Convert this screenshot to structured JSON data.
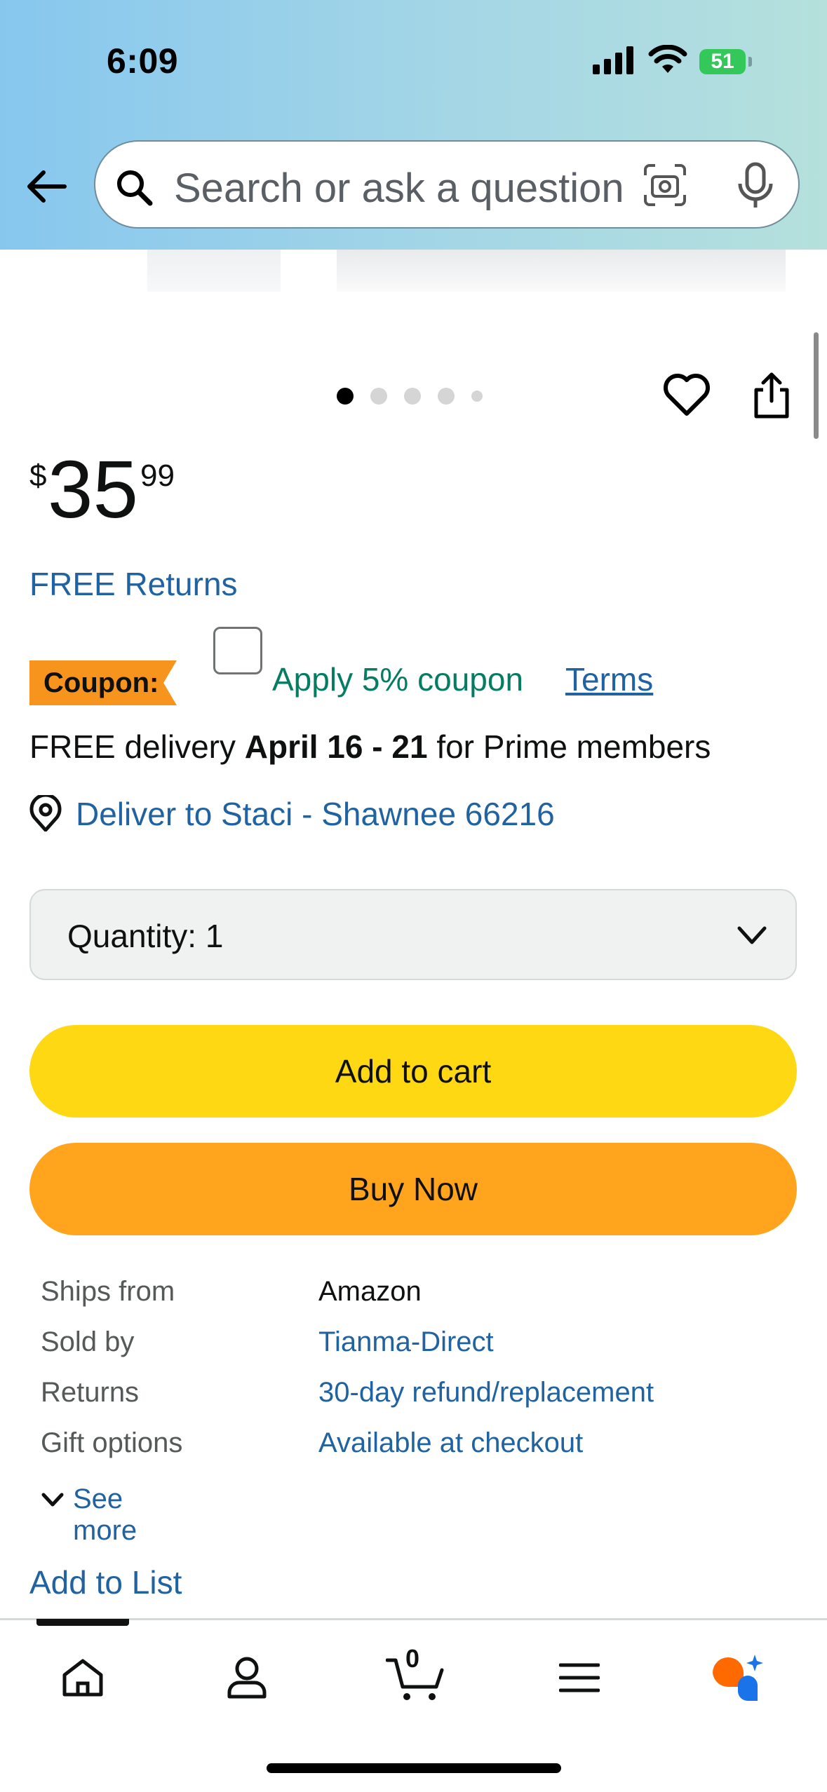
{
  "status_bar": {
    "time": "6:09",
    "battery": "51"
  },
  "search": {
    "placeholder": "Search or ask a question"
  },
  "gallery": {
    "dot_count": 5,
    "active_index": 0
  },
  "price": {
    "symbol": "$",
    "whole": "35",
    "fraction": "99"
  },
  "free_returns": "FREE Returns",
  "coupon": {
    "badge": "Coupon:",
    "text": "Apply 5% coupon",
    "terms": "Terms",
    "checked": false
  },
  "delivery": {
    "prefix": "FREE delivery",
    "dates": "April 16 - 21",
    "suffix": "for Prime members"
  },
  "deliver_to": "Deliver to Staci - Shawnee 66216",
  "quantity": {
    "label": "Quantity:",
    "value": "1"
  },
  "buttons": {
    "add_to_cart": "Add to cart",
    "buy_now": "Buy Now"
  },
  "info": [
    {
      "key": "Ships from",
      "value": "Amazon"
    },
    {
      "key": "Sold by",
      "value": "Tianma-Direct"
    },
    {
      "key": "Returns",
      "value": "30-day refund/replacement"
    },
    {
      "key": "Gift options",
      "value": "Available at checkout"
    }
  ],
  "see_more": "See more",
  "add_to_list": "Add to List",
  "bottom_nav": {
    "items": [
      "home-icon",
      "account-icon",
      "cart-icon",
      "menu-icon",
      "rufus-ai-icon"
    ],
    "cart_count": "0"
  },
  "colors": {
    "link": "#2162a1",
    "coupon_green": "#067d62",
    "add_to_cart": "#ffd814",
    "buy_now": "#ffa41c",
    "coupon_badge": "#f7941e"
  }
}
